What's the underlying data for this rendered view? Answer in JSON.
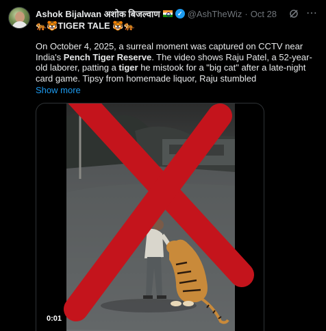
{
  "tweet": {
    "author_name": "Ashok Bijalwan अशोक बिजल्वाण",
    "handle": "@AshTheWiz",
    "separator": "·",
    "date": "Oct 28",
    "subtitle": "🐅🐯TIGER TALE 🐯🐅",
    "body_segments": [
      {
        "text": "On October 4, 2025, a surreal moment was captured on CCTV near India's ",
        "bold": false
      },
      {
        "text": "Pench Tiger Reserve",
        "bold": true
      },
      {
        "text": ". The video shows Raju Patel, a 52-year-old laborer, patting a ",
        "bold": false
      },
      {
        "text": "tiger",
        "bold": true
      },
      {
        "text": " he mistook for a \"big cat\" after a late-night card game. Tipsy from homemade liquor, Raju stumbled",
        "bold": false
      }
    ],
    "show_more": "Show more",
    "icons": {
      "flag": "india-flag-icon",
      "verified": "verified-badge-icon",
      "grok": "grok-icon",
      "more": "more-options-icon"
    },
    "colors": {
      "accent": "#1d9bf0",
      "secondary_text": "#71767b",
      "background": "#000000",
      "cross": "#c4141c"
    }
  },
  "media": {
    "type": "video",
    "timestamp": "0:01",
    "overlay": "red-x-cross"
  }
}
